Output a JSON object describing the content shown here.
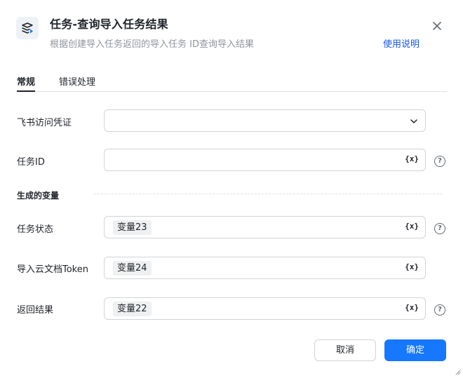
{
  "header": {
    "title": "任务-查询导入任务结果",
    "subtitle": "根据创建导入任务返回的导入任务 ID查询导入结果",
    "help_link": "使用说明",
    "icon": "import-task-icon",
    "close_icon": "close-icon"
  },
  "tabs": [
    {
      "label": "常规",
      "active": true
    },
    {
      "label": "错误处理",
      "active": false
    }
  ],
  "fields": {
    "credential": {
      "label": "飞书访问凭证",
      "value": ""
    },
    "task_id": {
      "label": "任务ID",
      "value": "",
      "var_symbol": "{x}"
    }
  },
  "outputs": {
    "section_title": "生成的变量",
    "task_status": {
      "label": "任务状态",
      "chip": "变量23",
      "var_symbol": "{x}"
    },
    "token": {
      "label": "导入云文档Token",
      "chip": "变量24",
      "var_symbol": "{x}"
    },
    "result": {
      "label": "返回结果",
      "chip": "变量22",
      "var_symbol": "{x}"
    }
  },
  "help_symbol": "?",
  "buttons": {
    "cancel": "取消",
    "confirm": "确定"
  },
  "colors": {
    "primary": "#1677ff",
    "link": "#1456f0",
    "text": "#1f2329",
    "muted": "#8f959e"
  }
}
